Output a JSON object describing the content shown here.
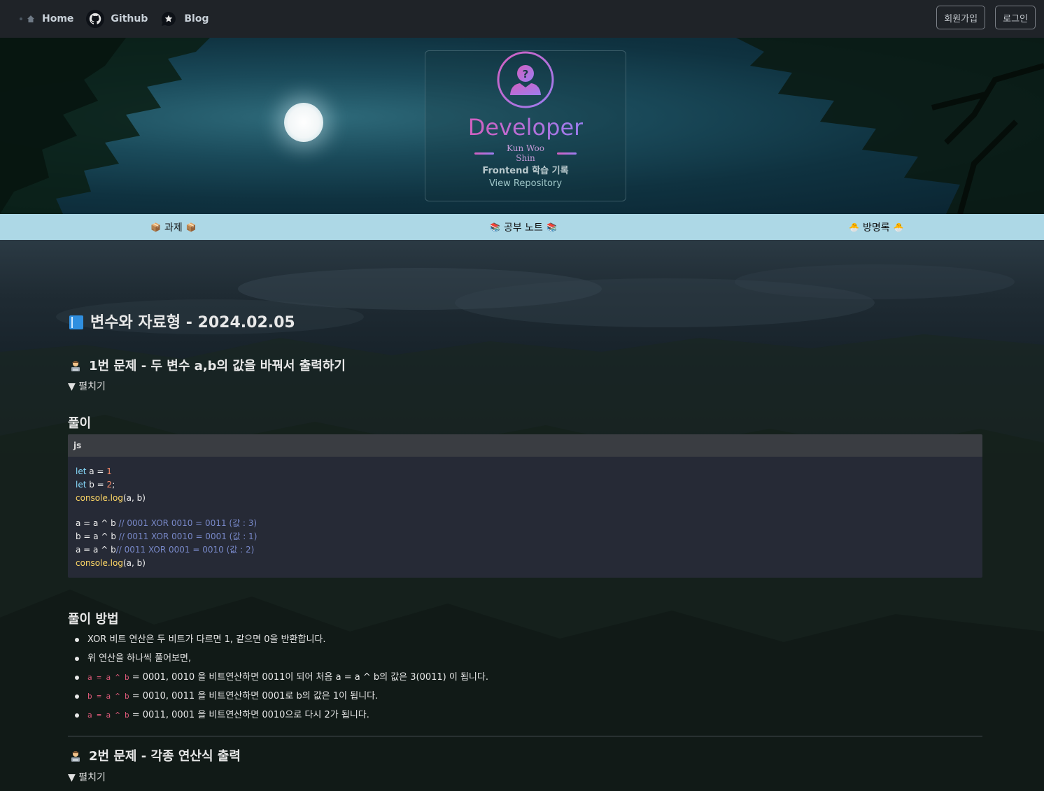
{
  "topbar": {
    "home_label": "Home",
    "github_label": "Github",
    "blog_label": "Blog",
    "signup_label": "회원가입",
    "login_label": "로그인"
  },
  "hero": {
    "title": "Developer",
    "name": "Kun Woo Shin",
    "subtitle": "Frontend 학습 기록",
    "repo_link": "View Repository"
  },
  "categories": {
    "assignment": "과제",
    "notes": "공부 노트",
    "guestbook": "방명록"
  },
  "post": {
    "title": "변수와 자료형 - 2024.02.05",
    "problem1": {
      "title": "1번 문제 - 두 변수 a,b의 값을 바꿔서 출력하기",
      "toggle": "▼ 펼치기"
    },
    "solution_heading": "풀이",
    "code": {
      "lang": "js",
      "lines": [
        "let a = 1",
        "let b = 2;",
        "console.log(a, b)",
        "",
        "a = a ^ b // 0001 XOR 0010 = 0011 (값 : 3)",
        "b = a ^ b // 0011 XOR 0010 = 0001 (값 : 1)",
        "a = a ^ b// 0011 XOR 0001 = 0010 (값 : 2)",
        "console.log(a, b)"
      ]
    },
    "method_heading": "풀이 방법",
    "method_items": [
      {
        "code": "",
        "text": "XOR 비트 연산은 두 비트가 다르면 1, 같으면 0을 반환합니다."
      },
      {
        "code": "",
        "text": "위 연산을 하나씩 풀어보면,"
      },
      {
        "code": "a = a ^ b",
        "text": " = 0001, 0010 을 비트연산하면 0011이 되어 처음 a = a ^ b의 값은 3(0011) 이 됩니다."
      },
      {
        "code": "b = a ^ b",
        "text": " = 0010, 0011 을 비트연산하면 0001로 b의 값은 1이 됩니다."
      },
      {
        "code": "a = a ^ b",
        "text": " = 0011, 0001 을 비트연산하면 0010으로 다시 2가 됩니다."
      }
    ],
    "problem2": {
      "title": "2번 문제 - 각종 연산식 출력",
      "toggle": "▼ 펼치기"
    }
  },
  "colors": {
    "topbar_bg": "#1f2328",
    "category_bar_bg": "#add8e6",
    "accent_gradient_start": "#d260c0",
    "accent_gradient_end": "#9c7df0",
    "code_bg": "#262a36",
    "inline_code": "#e35b7c"
  }
}
